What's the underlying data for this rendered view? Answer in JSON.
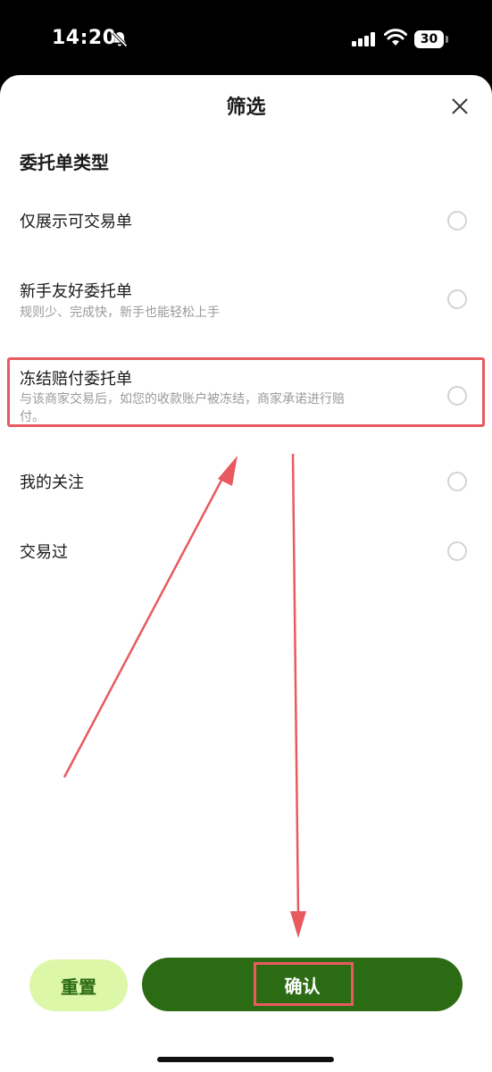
{
  "status_bar": {
    "time": "14:20",
    "battery_level": "30"
  },
  "sheet": {
    "title": "筛选",
    "section_title": "委托单类型"
  },
  "options": [
    {
      "label": "仅展示可交易单",
      "desc": "",
      "selected": false
    },
    {
      "label": "新手友好委托单",
      "desc": "规则少、完成快，新手也能轻松上手",
      "selected": false
    },
    {
      "label": "冻结赔付委托单",
      "desc": "与该商家交易后，如您的收款账户被冻结，商家承诺进行赔付。",
      "selected": false
    },
    {
      "label": "我的关注",
      "desc": "",
      "selected": false
    },
    {
      "label": "交易过",
      "desc": "",
      "selected": false
    }
  ],
  "buttons": {
    "reset_label": "重置",
    "confirm_label": "确认"
  },
  "colors": {
    "primary": "#2b6b14",
    "reset_bg": "#ddf7a8",
    "reset_text": "#2a6a10",
    "annotation": "#e85a5f",
    "radio_border": "#d4d4d4"
  }
}
